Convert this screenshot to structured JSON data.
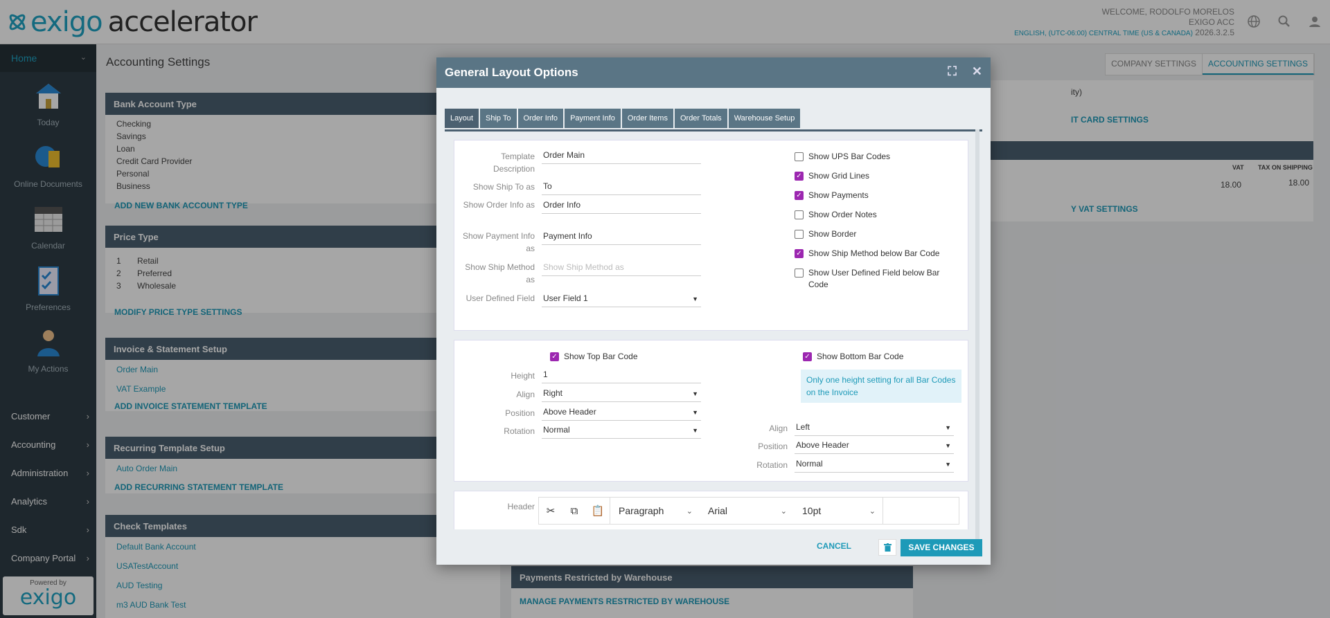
{
  "header": {
    "logo_brand": "exigo",
    "logo_product": "accelerator",
    "welcome": "WELCOME, RODOLFO MORELOS",
    "company": "EXIGO ACC",
    "locale": "ENGLISH, (UTC-06:00) CENTRAL TIME (US & CANADA)",
    "version": "2026.3.2.5"
  },
  "sidebar": {
    "home": "Home",
    "tiles": [
      {
        "label": "Today"
      },
      {
        "label": "Online Documents"
      },
      {
        "label": "Calendar"
      },
      {
        "label": "Preferences"
      },
      {
        "label": "My Actions"
      }
    ],
    "nav": [
      {
        "label": "Customer"
      },
      {
        "label": "Accounting"
      },
      {
        "label": "Administration"
      },
      {
        "label": "Analytics"
      },
      {
        "label": "Sdk"
      },
      {
        "label": "Company Portal"
      }
    ],
    "powered": "Powered by",
    "powered_logo": "exigo"
  },
  "page": {
    "title": "Accounting Settings",
    "tabs": [
      "COMPANY SETTINGS",
      "ACCOUNTING SETTINGS"
    ]
  },
  "bank": {
    "title": "Bank Account Type",
    "items": [
      "Checking",
      "Savings",
      "Loan",
      "Credit Card Provider",
      "Personal",
      "Business"
    ],
    "action": "ADD NEW BANK ACCOUNT TYPE"
  },
  "price": {
    "title": "Price Type",
    "items": [
      {
        "n": "1",
        "v": "Retail"
      },
      {
        "n": "2",
        "v": "Preferred"
      },
      {
        "n": "3",
        "v": "Wholesale"
      }
    ],
    "action": "MODIFY PRICE TYPE SETTINGS"
  },
  "invoice": {
    "title": "Invoice & Statement Setup",
    "items": [
      "Order Main",
      "VAT Example"
    ],
    "action": "ADD INVOICE STATEMENT TEMPLATE"
  },
  "recurring": {
    "title": "Recurring Template Setup",
    "items": [
      "Auto Order Main"
    ],
    "action": "ADD RECURRING STATEMENT TEMPLATE"
  },
  "check": {
    "title": "Check Templates",
    "items": [
      "Default Bank Account",
      "USATestAccount",
      "AUD Testing",
      "m3 AUD Bank Test"
    ]
  },
  "right": {
    "frag1": "ity)",
    "frag2": "IT CARD SETTINGS",
    "vat_hdr": "VAT",
    "taxship_hdr": "TAX ON SHIPPING",
    "vat_val": "18.00",
    "taxship_val": "18.00",
    "frag3": "Y VAT SETTINGS",
    "pay_title": "Payments Restricted by Warehouse",
    "pay_action": "MANAGE PAYMENTS RESTRICTED BY WAREHOUSE"
  },
  "modal": {
    "title": "General Layout Options",
    "tabs": [
      "Layout",
      "Ship To",
      "Order Info",
      "Payment Info",
      "Order Items",
      "Order Totals",
      "Warehouse Setup"
    ],
    "fields": {
      "template_lbl": "Template Description",
      "template_val": "Order Main",
      "shipto_lbl": "Show Ship To as",
      "shipto_val": "To",
      "orderinfo_lbl": "Show Order Info as",
      "orderinfo_val": "Order Info",
      "payinfo_lbl": "Show Payment Info as",
      "payinfo_val": "Payment Info",
      "shipmethod_lbl": "Show Ship Method as",
      "shipmethod_ph": "Show Ship Method as",
      "udf_lbl": "User Defined Field",
      "udf_val": "User Field 1"
    },
    "checks": [
      {
        "label": "Show UPS Bar Codes",
        "checked": false
      },
      {
        "label": "Show Grid Lines",
        "checked": true
      },
      {
        "label": "Show Payments",
        "checked": true
      },
      {
        "label": "Show Order Notes",
        "checked": false
      },
      {
        "label": "Show Border",
        "checked": false
      },
      {
        "label": "Show Ship Method below Bar Code",
        "checked": true
      },
      {
        "label": "Show User Defined Field below Bar Code",
        "checked": false
      }
    ],
    "barcode": {
      "top_lbl": "Show Top Bar Code",
      "bottom_lbl": "Show Bottom Bar Code",
      "height_lbl": "Height",
      "height_val": "1",
      "align_lbl": "Align",
      "align_val": "Right",
      "position_lbl": "Position",
      "position_val": "Above Header",
      "rotation_lbl": "Rotation",
      "rotation_val": "Normal",
      "note": "Only one height setting for all Bar Codes on the Invoice",
      "b_align_val": "Left",
      "b_position_val": "Above Header",
      "b_rotation_val": "Normal"
    },
    "header_lbl": "Header",
    "toolbar": {
      "paragraph": "Paragraph",
      "font": "Arial",
      "size": "10pt"
    },
    "cancel": "CANCEL",
    "save": "SAVE CHANGES"
  },
  "colors": {
    "accent": "#1e9ab8",
    "header_bg": "#4b6070",
    "check": "#9c27b0"
  }
}
